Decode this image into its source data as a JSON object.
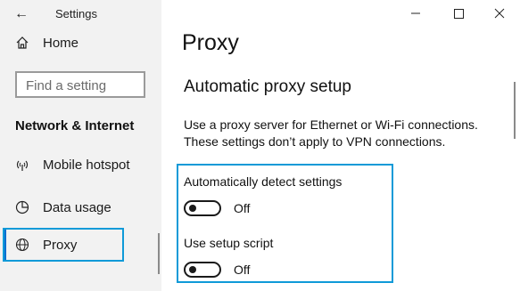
{
  "app": {
    "title": "Settings",
    "back_icon": "arrow-left-icon"
  },
  "sidebar": {
    "home_label": "Home",
    "search_placeholder": "Find a setting",
    "section_heading": "Network & Internet",
    "items": [
      {
        "label": "Mobile hotspot",
        "icon": "mobile-hotspot-icon"
      },
      {
        "label": "Data usage",
        "icon": "data-usage-icon"
      },
      {
        "label": "Proxy",
        "icon": "globe-icon",
        "selected": true
      }
    ]
  },
  "window_controls": [
    "minimize-icon",
    "maximize-icon",
    "close-icon"
  ],
  "main": {
    "title": "Proxy",
    "section_title": "Automatic proxy setup",
    "description_line1": "Use a proxy server for Ethernet or Wi-Fi connections.",
    "description_line2": "These settings don’t apply to VPN connections.",
    "settings": [
      {
        "label": "Automatically detect settings",
        "state": "Off"
      },
      {
        "label": "Use setup script",
        "state": "Off"
      }
    ]
  },
  "colors": {
    "highlight": "#0f9ad8",
    "accent": "#0a6fd0",
    "sidebar_bg": "#f2f2f2"
  }
}
